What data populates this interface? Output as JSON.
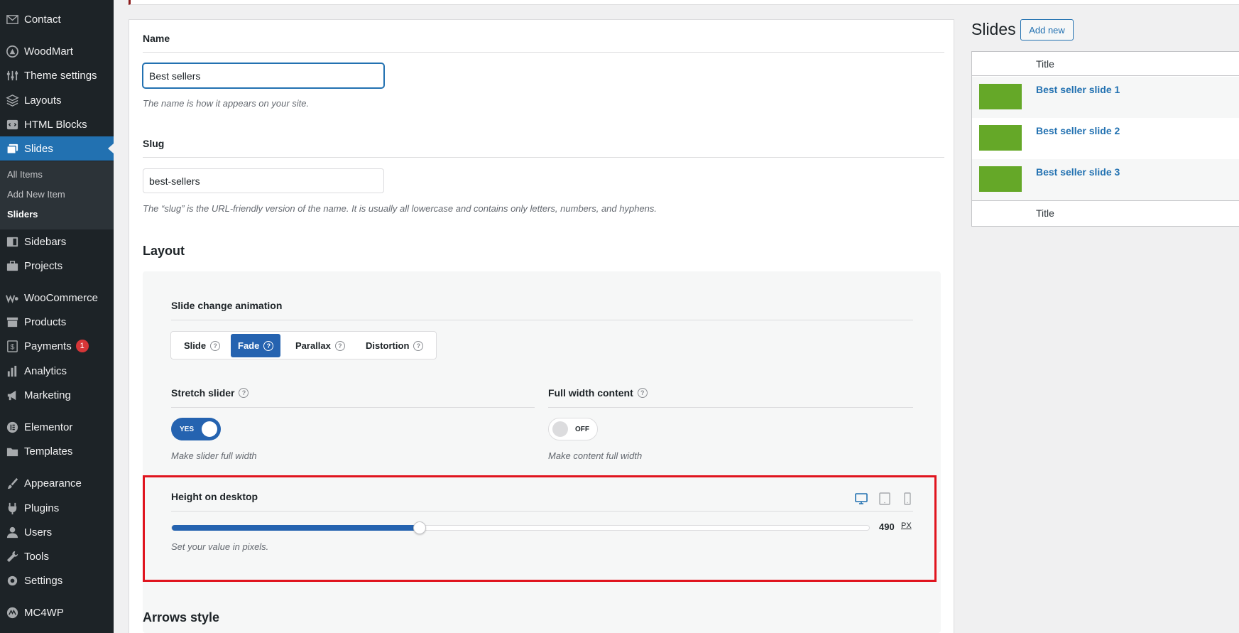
{
  "sidebar": {
    "items": [
      {
        "label": "Contact",
        "icon": "mail-icon"
      },
      {
        "label": "WoodMart",
        "icon": "woodmart-icon"
      },
      {
        "label": "Theme settings",
        "icon": "sliders-icon"
      },
      {
        "label": "Layouts",
        "icon": "layers-icon"
      },
      {
        "label": "HTML Blocks",
        "icon": "code-block-icon"
      },
      {
        "label": "Slides",
        "icon": "images-icon"
      },
      {
        "label": "Sidebars",
        "icon": "sidebar-icon"
      },
      {
        "label": "Projects",
        "icon": "briefcase-icon"
      },
      {
        "label": "WooCommerce",
        "icon": "woo-icon"
      },
      {
        "label": "Products",
        "icon": "archive-icon"
      },
      {
        "label": "Payments",
        "icon": "dollar-icon",
        "badge": "1"
      },
      {
        "label": "Analytics",
        "icon": "bar-chart-icon"
      },
      {
        "label": "Marketing",
        "icon": "megaphone-icon"
      },
      {
        "label": "Elementor",
        "icon": "elementor-icon"
      },
      {
        "label": "Templates",
        "icon": "folder-icon"
      },
      {
        "label": "Appearance",
        "icon": "brush-icon"
      },
      {
        "label": "Plugins",
        "icon": "plug-icon"
      },
      {
        "label": "Users",
        "icon": "user-icon"
      },
      {
        "label": "Tools",
        "icon": "wrench-icon"
      },
      {
        "label": "Settings",
        "icon": "settings-icon"
      },
      {
        "label": "MC4WP",
        "icon": "mc4wp-icon"
      }
    ],
    "submenu": [
      "All Items",
      "Add New Item",
      "Sliders"
    ]
  },
  "form": {
    "name_label": "Name",
    "name_value": "Best sellers",
    "name_help": "The name is how it appears on your site.",
    "slug_label": "Slug",
    "slug_value": "best-sellers",
    "slug_help": "The “slug” is the URL-friendly version of the name. It is usually all lowercase and contains only letters, numbers, and hyphens.",
    "layout_title": "Layout",
    "animation_label": "Slide change animation",
    "animation_options": [
      "Slide",
      "Fade",
      "Parallax",
      "Distortion"
    ],
    "stretch_label": "Stretch slider",
    "stretch_toggle": "YES",
    "stretch_help": "Make slider full width",
    "fullwidth_label": "Full width content",
    "fullwidth_toggle": "OFF",
    "fullwidth_help": "Make content full width",
    "height_label": "Height on desktop",
    "height_value": "490",
    "height_unit": "PX",
    "height_fraction": 0.355,
    "height_help": "Set your value in pixels.",
    "arrows_title": "Arrows style"
  },
  "slides_panel": {
    "title": "Slides",
    "add_new": "Add new",
    "column": "Title",
    "rows": [
      "Best seller slide 1",
      "Best seller slide 2",
      "Best seller slide 3"
    ],
    "footer_column": "Title"
  },
  "colors": {
    "accent": "#2271b1",
    "thumb": "#65a828",
    "highlight": "#e0141e"
  }
}
